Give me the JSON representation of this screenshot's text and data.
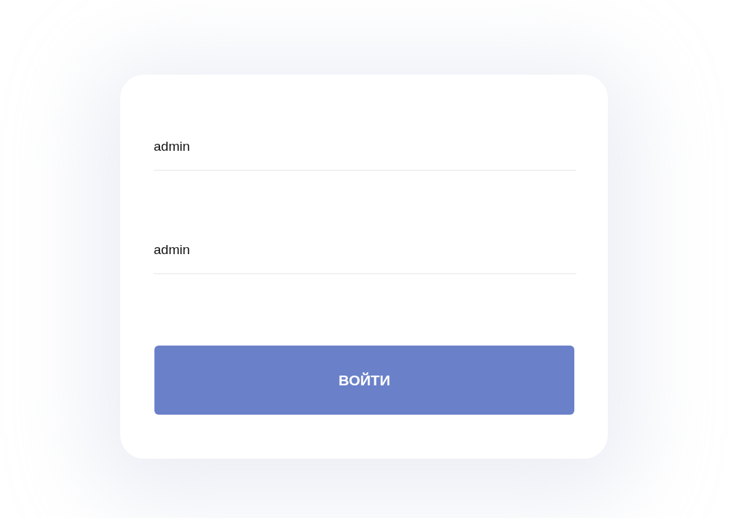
{
  "login_form": {
    "fields": [
      {
        "value": "admin"
      },
      {
        "value": "admin"
      }
    ],
    "submit_button": {
      "label": "ВОЙТИ"
    }
  }
}
